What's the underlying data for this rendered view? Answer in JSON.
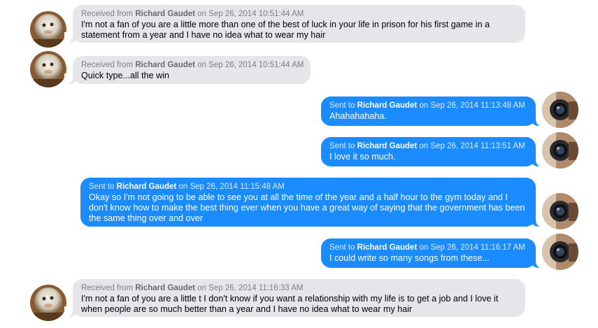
{
  "conversation": {
    "contact_name": "Richard Gaudet",
    "messages": [
      {
        "direction": "received",
        "meta_prefix": "Received from ",
        "contact": "Richard Gaudet",
        "meta_suffix": " on Sep 26, 2014 10:51:44 AM",
        "text": "I'm not a fan of you are a little more than one of the best of luck in your life in prison for his first game in a statement from a year and I have no idea what to wear my hair",
        "avatar": "contact-avatar"
      },
      {
        "direction": "received",
        "meta_prefix": "Received from ",
        "contact": "Richard Gaudet",
        "meta_suffix": " on Sep 26, 2014 10:51:44 AM",
        "text": "Quick type...all the win",
        "avatar": "contact-avatar"
      },
      {
        "direction": "sent",
        "meta_prefix": "Sent to ",
        "contact": "Richard Gaudet",
        "meta_suffix": " on Sep 26, 2014 11:13:48 AM",
        "text": "Ahahahahaha.",
        "avatar": "user-camera-avatar"
      },
      {
        "direction": "sent",
        "meta_prefix": "Sent to ",
        "contact": "Richard Gaudet",
        "meta_suffix": " on Sep 26, 2014 11:13:51 AM",
        "text": "I love it so much.",
        "avatar": "user-camera-avatar"
      },
      {
        "direction": "sent",
        "meta_prefix": "Sent to ",
        "contact": "Richard Gaudet",
        "meta_suffix": " on Sep 26, 2014 11:15:48 AM",
        "text": "Okay so I'm not going to be able to see you at all the time of the year and a half hour to the gym today and I don't know how to make the best thing ever when you have a great way of saying that the government has been the same thing over and over",
        "avatar": "user-camera-avatar"
      },
      {
        "direction": "sent",
        "meta_prefix": "Sent to ",
        "contact": "Richard Gaudet",
        "meta_suffix": " on Sep 26, 2014 11:16:17 AM",
        "text": "I could write so many songs from these...",
        "avatar": "user-camera-avatar"
      },
      {
        "direction": "received",
        "meta_prefix": "Received from ",
        "contact": "Richard Gaudet",
        "meta_suffix": " on Sep 26, 2014 11:16:33 AM",
        "text": "I'm not a fan of you are a little t I don't know if you want a relationship with my life is to get a job and I love it when people are so much better than a year and I have no idea what to wear my hair",
        "avatar": "contact-avatar"
      }
    ]
  },
  "colors": {
    "received_bubble": "#e5e5ea",
    "sent_bubble": "#1a8cff",
    "background": "#ffffff"
  }
}
